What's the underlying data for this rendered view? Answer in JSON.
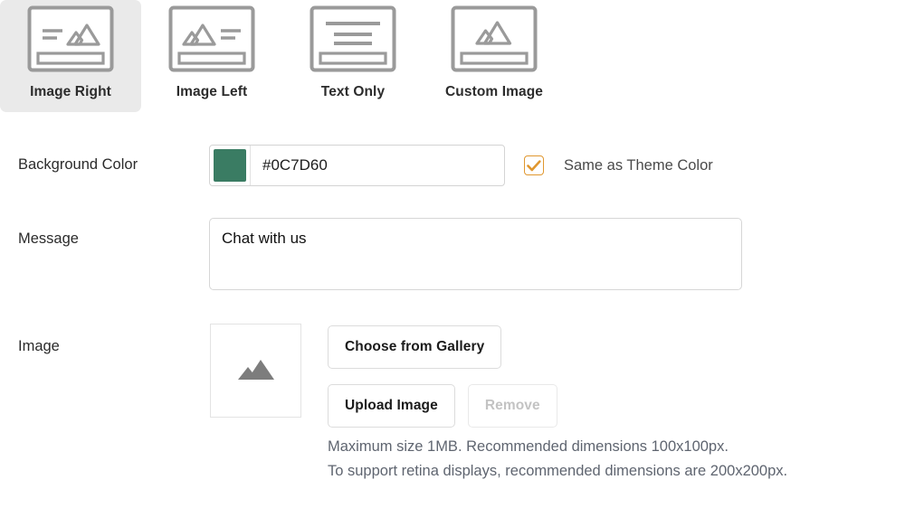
{
  "layout_options": [
    {
      "label": "Image Right",
      "icon": "layout-image-right-icon",
      "selected": true
    },
    {
      "label": "Image Left",
      "icon": "layout-image-left-icon",
      "selected": false
    },
    {
      "label": "Text Only",
      "icon": "layout-text-only-icon",
      "selected": false
    },
    {
      "label": "Custom Image",
      "icon": "layout-custom-image-icon",
      "selected": false
    }
  ],
  "background_color": {
    "label": "Background Color",
    "value": "#0C7D60",
    "swatch_color": "#3A7C63",
    "same_as_theme": {
      "label": "Same as Theme Color",
      "checked": true,
      "accent_color": "#E0972F"
    }
  },
  "message": {
    "label": "Message",
    "value": "Chat with us",
    "placeholder": ""
  },
  "image": {
    "label": "Image",
    "thumbnail_icon": "mountain-image-icon",
    "buttons": {
      "choose_from_gallery": "Choose from Gallery",
      "upload_image": "Upload Image",
      "remove": "Remove",
      "remove_disabled": true
    },
    "hints": [
      "Maximum size 1MB. Recommended dimensions 100x100px.",
      "To support retina displays, recommended dimensions are 200x200px."
    ]
  }
}
